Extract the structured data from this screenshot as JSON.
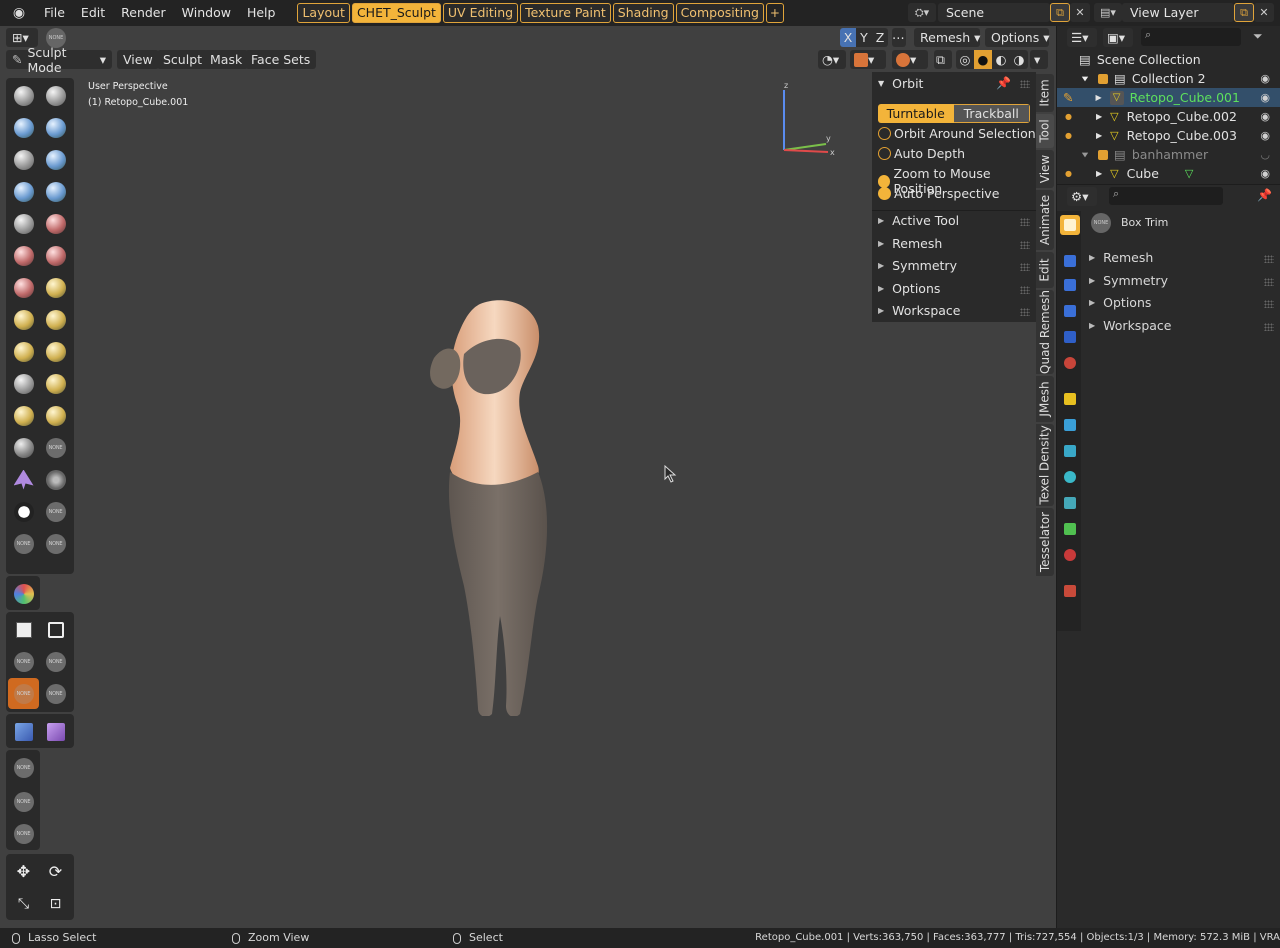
{
  "topbar": {
    "menus": [
      "File",
      "Edit",
      "Render",
      "Window",
      "Help"
    ],
    "workspaces": [
      {
        "label": "Layout",
        "active": false
      },
      {
        "label": "CHET_Sculpt",
        "active": true
      },
      {
        "label": "UV Editing",
        "active": false
      },
      {
        "label": "Texture Paint",
        "active": false
      },
      {
        "label": "Shading",
        "active": false
      },
      {
        "label": "Compositing",
        "active": false
      }
    ],
    "add_tab": "+",
    "scene_name": "Scene",
    "view_layer_name": "View Layer"
  },
  "viewport_header": {
    "axes": [
      "X",
      "Y",
      "Z"
    ],
    "remesh_label": "Remesh",
    "options_label": "Options",
    "mode_label": "Sculpt Mode",
    "menus": [
      "View",
      "Sculpt",
      "Mask",
      "Face Sets"
    ],
    "brush_badge": "NONE"
  },
  "viewport": {
    "perspective_label": "User Perspective",
    "object_label": "(1) Retopo_Cube.001",
    "gizmo_axes": {
      "x": "x",
      "y": "y",
      "z": "z"
    }
  },
  "toolbar": {
    "none_label": "NONE"
  },
  "npanel": {
    "orbit_title": "Orbit",
    "turntable": "Turntable",
    "trackball": "Trackball",
    "options": [
      {
        "label": "Orbit Around Selection",
        "checked": false
      },
      {
        "label": "Auto Depth",
        "checked": false
      },
      {
        "label": "Zoom to Mouse Position",
        "checked": true
      },
      {
        "label": "Auto Perspective",
        "checked": true
      }
    ],
    "sections": [
      "Active Tool",
      "Remesh",
      "Symmetry",
      "Options",
      "Workspace"
    ]
  },
  "side_tabs": [
    "Item",
    "Tool",
    "View",
    "Animate",
    "Edit",
    "Quad Remesh",
    "JMesh",
    "Texel Density",
    "Tesselator"
  ],
  "outliner": {
    "root": "Scene Collection",
    "rows": [
      {
        "label": "Collection 2",
        "indent": 1,
        "type": "collection"
      },
      {
        "label": "Retopo_Cube.001",
        "indent": 2,
        "type": "mesh",
        "active": true
      },
      {
        "label": "Retopo_Cube.002",
        "indent": 2,
        "type": "mesh"
      },
      {
        "label": "Retopo_Cube.003",
        "indent": 2,
        "type": "mesh"
      },
      {
        "label": "banhammer",
        "indent": 1,
        "type": "collection",
        "dim": true
      },
      {
        "label": "Cube",
        "indent": 2,
        "type": "mesh"
      }
    ]
  },
  "properties": {
    "tool_name": "Box Trim",
    "none_label": "NONE",
    "sections": [
      "Remesh",
      "Symmetry",
      "Options",
      "Workspace"
    ],
    "tab_colors": [
      "#f3b43a",
      "#3a6fd8",
      "#3a6fd8",
      "#3a6fd8",
      "#2f5fc8",
      "#c8453a",
      "#e8c020",
      "#3a9fd8",
      "#39a8c8",
      "#3ab8c8",
      "#45a8b8",
      "#50c050",
      "#c83a3a",
      "#c84a3a"
    ]
  },
  "statusbar": {
    "left_action": "Lasso Select",
    "middle_action": "Zoom View",
    "right_action": "Select",
    "stats": "Retopo_Cube.001 | Verts:363,750 | Faces:363,777 | Tris:727,554 | Objects:1/3 | Memory: 572.3 MiB | VRA"
  },
  "colors": {
    "accent": "#f3b43a",
    "viewport_bg": "#404040",
    "active_object": "#5de05d"
  }
}
